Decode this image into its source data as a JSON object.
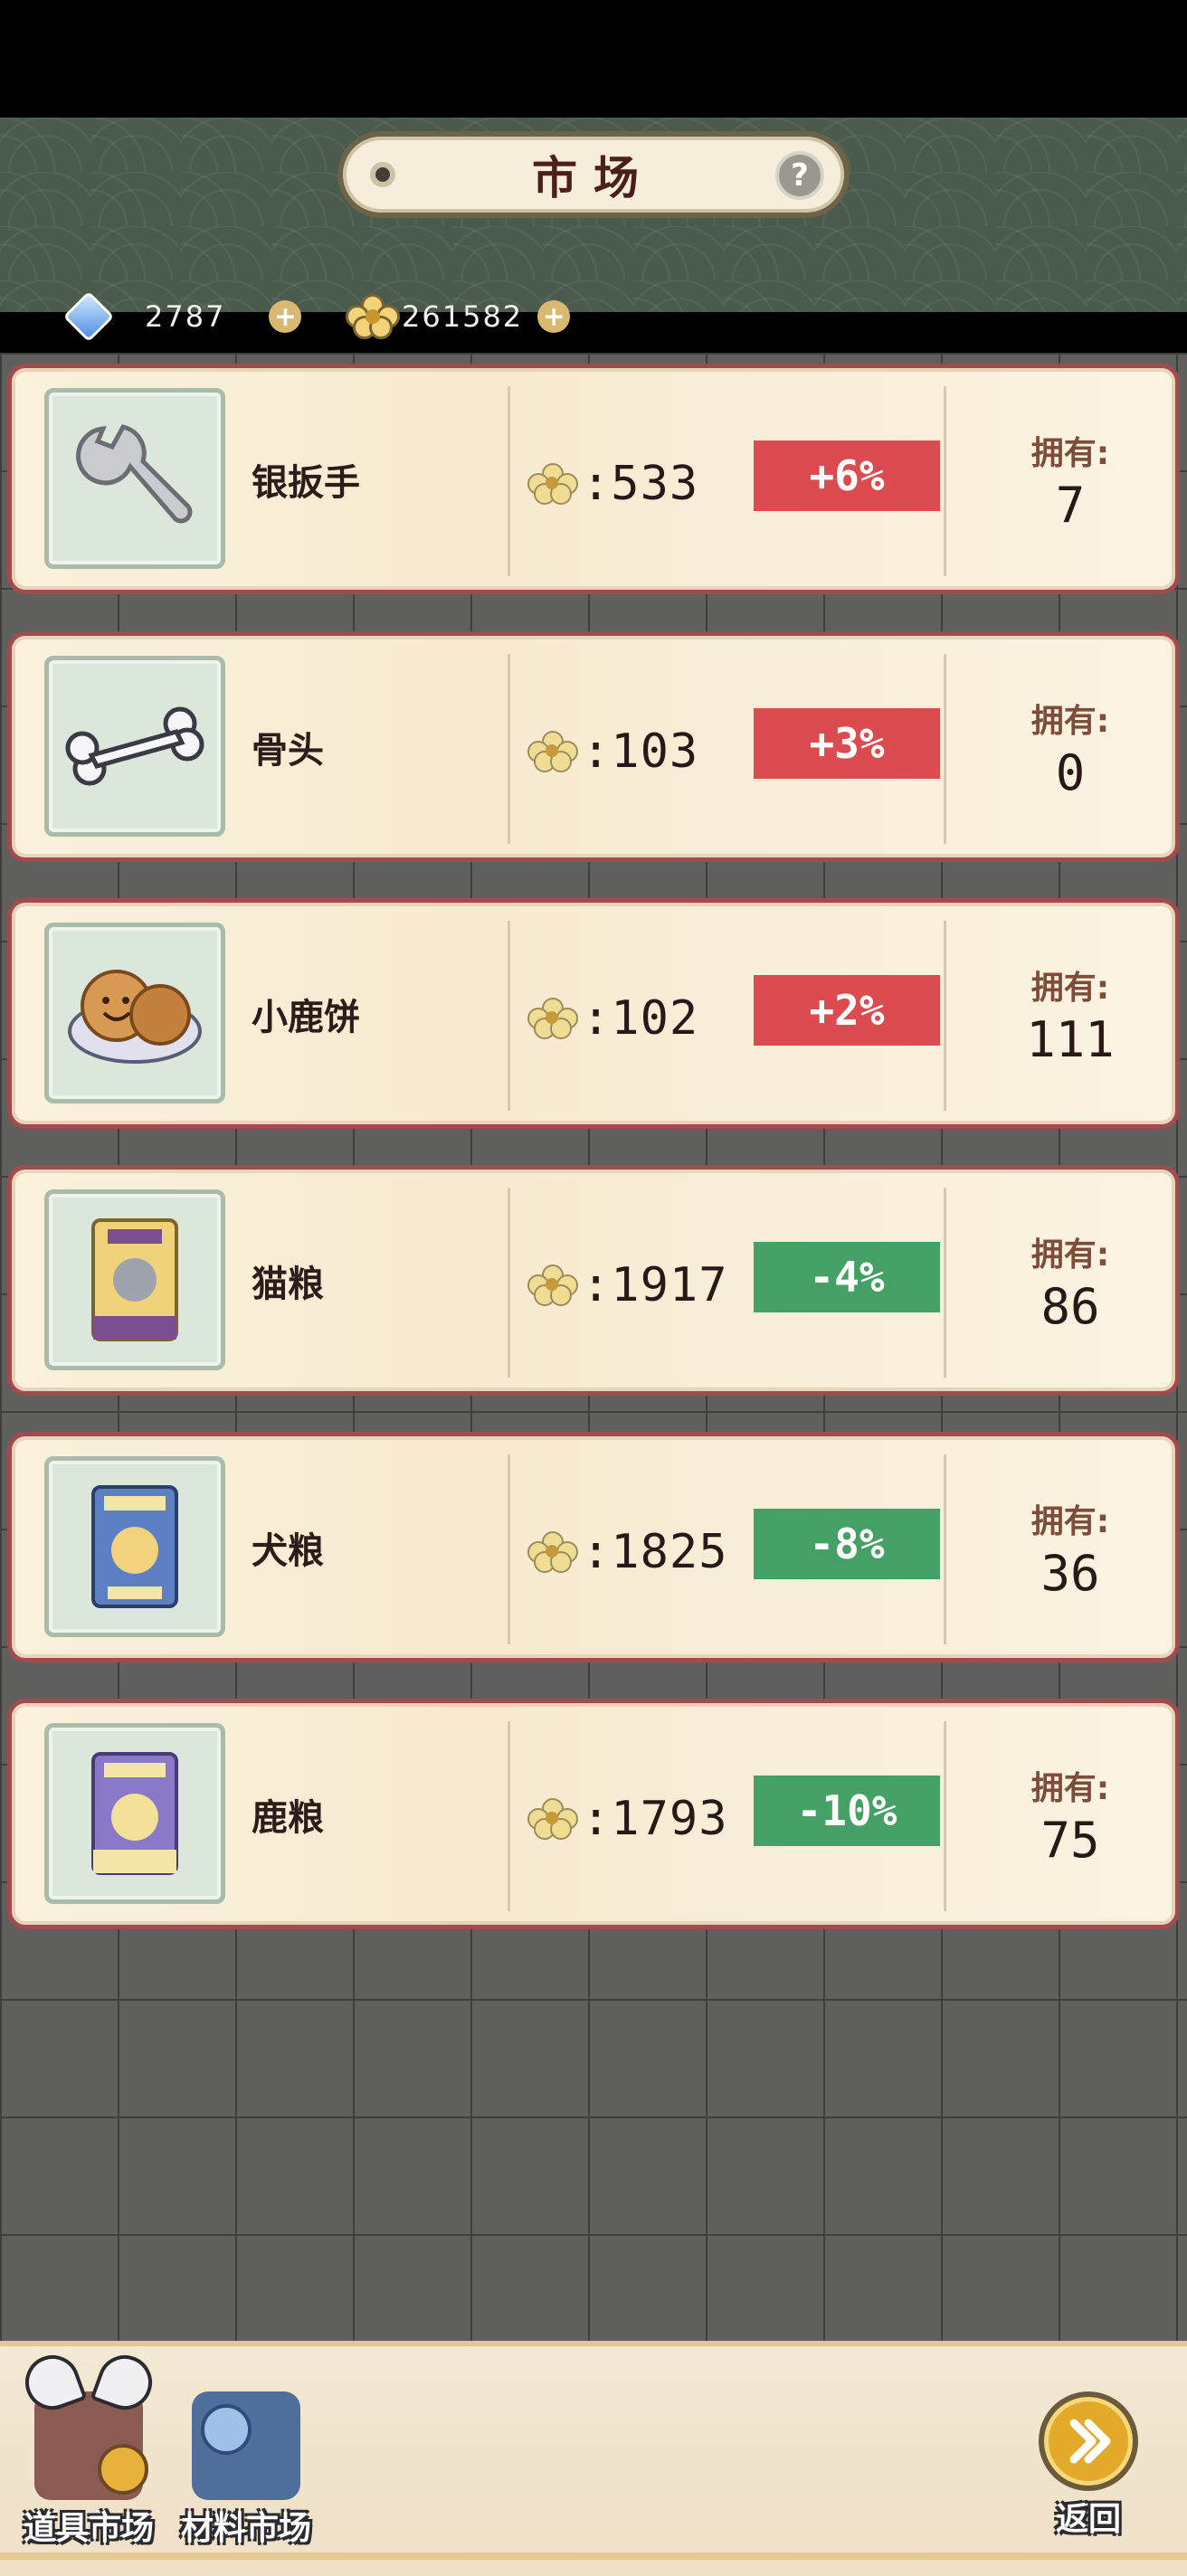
{
  "header": {
    "title": "市场"
  },
  "currency": {
    "gems": "2787",
    "flowers": "261582"
  },
  "items": [
    {
      "name": "银扳手",
      "price": ":533",
      "change": "+6%",
      "trend": "up",
      "owned_label": "拥有:",
      "owned": "7",
      "icon": "wrench-icon"
    },
    {
      "name": "骨头",
      "price": ":103",
      "change": "+3%",
      "trend": "up",
      "owned_label": "拥有:",
      "owned": "0",
      "icon": "bone-icon"
    },
    {
      "name": "小鹿饼",
      "price": ":102",
      "change": "+2%",
      "trend": "up",
      "owned_label": "拥有:",
      "owned": "111",
      "icon": "cookie-icon"
    },
    {
      "name": "猫粮",
      "price": ":1917",
      "change": "-4%",
      "trend": "down",
      "owned_label": "拥有:",
      "owned": "86",
      "icon": "cat-food-icon"
    },
    {
      "name": "犬粮",
      "price": ":1825",
      "change": "-8%",
      "trend": "down",
      "owned_label": "拥有:",
      "owned": "36",
      "icon": "dog-food-icon"
    },
    {
      "name": "鹿粮",
      "price": ":1793",
      "change": "-10%",
      "trend": "down",
      "owned_label": "拥有:",
      "owned": "75",
      "icon": "deer-food-icon"
    }
  ],
  "colors": {
    "up": "#db4b4f",
    "down": "#45a065"
  },
  "bottom_nav": {
    "tool_market": "道具市场",
    "material_market": "材料市场",
    "back": "返回"
  }
}
